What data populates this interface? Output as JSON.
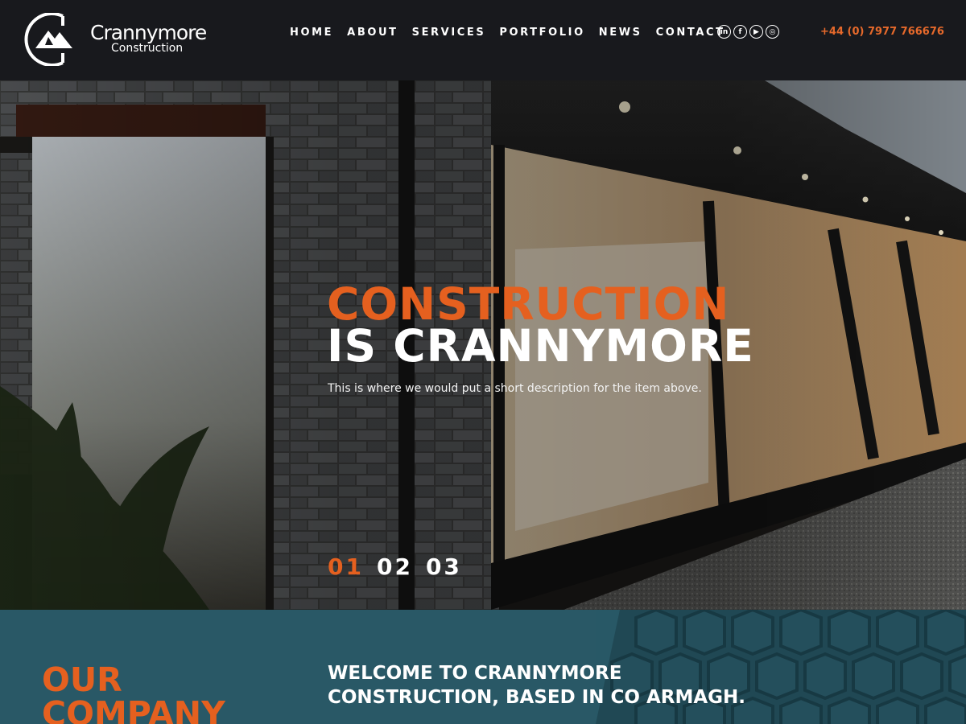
{
  "brand": {
    "name": "Crannymore",
    "sub": "Construction"
  },
  "nav": {
    "items": [
      "HOME",
      "ABOUT",
      "SERVICES",
      "PORTFOLIO",
      "NEWS",
      "CONTACT"
    ]
  },
  "social": {
    "icons": [
      {
        "name": "linkedin-icon",
        "glyph": "in"
      },
      {
        "name": "facebook-icon",
        "glyph": "f"
      },
      {
        "name": "youtube-icon",
        "glyph": "▶"
      },
      {
        "name": "instagram-icon",
        "glyph": "◎"
      }
    ]
  },
  "header": {
    "phone": "+44 (0) 7977 766676"
  },
  "hero": {
    "title_line1": "CONSTRUCTION",
    "title_line2": "IS CRANNYMORE",
    "description": "This is where we would put a short description for the item above.",
    "slides": [
      "01",
      "02",
      "03"
    ],
    "active_slide": "01"
  },
  "company": {
    "heading_line1": "OUR",
    "heading_line2": "COMPANY",
    "welcome_line1": "WELCOME TO CRANNYMORE",
    "welcome_line2": "CONSTRUCTION, BASED IN CO ARMAGH."
  },
  "colors": {
    "accent": "#e5601f",
    "header_bg": "#18191d",
    "company_bg": "#295866"
  }
}
